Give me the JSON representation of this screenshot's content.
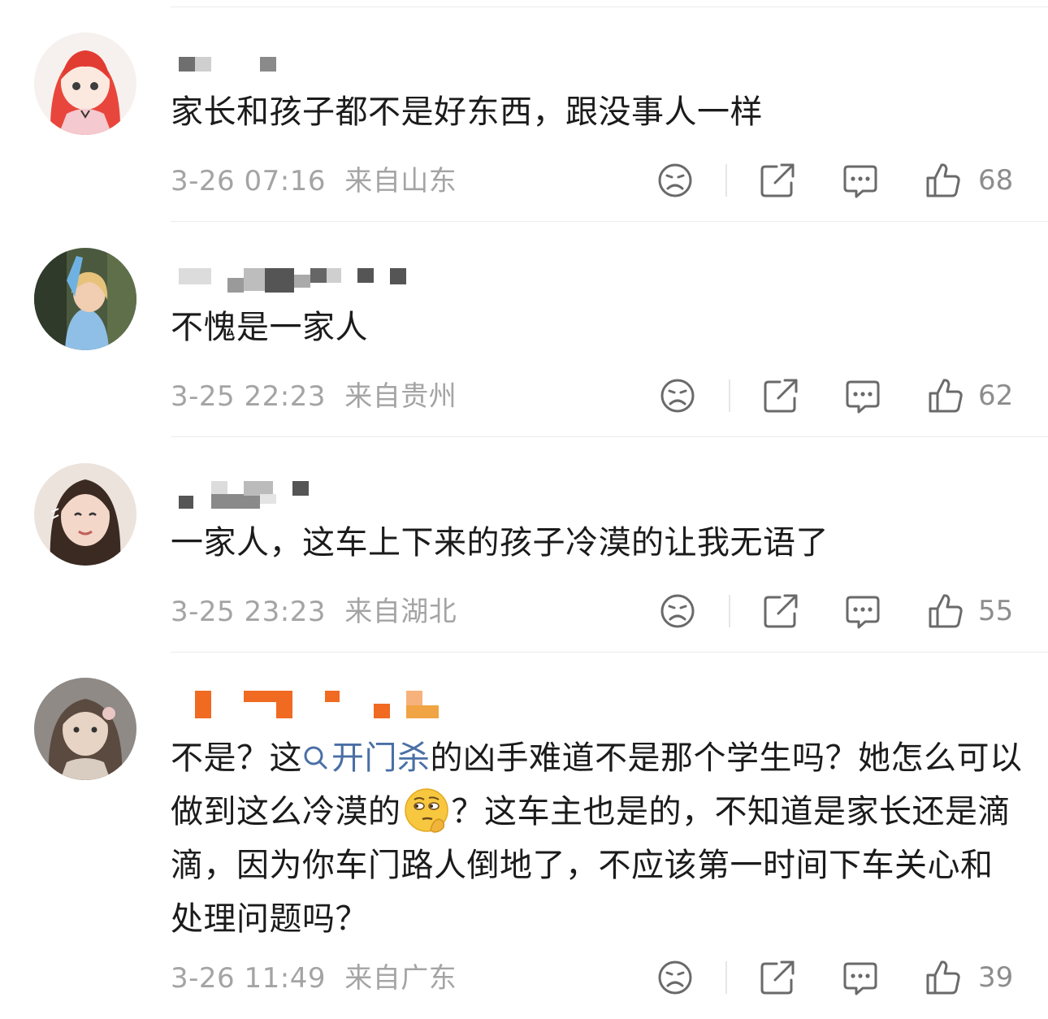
{
  "comments": [
    {
      "content": "家长和孩子都不是好东西，跟没事人一样",
      "time": "3-26 07:16",
      "location": "来自山东",
      "likes": "68"
    },
    {
      "content": "不愧是一家人",
      "time": "3-25 22:23",
      "location": "来自贵州",
      "likes": "62"
    },
    {
      "content": "一家人，这车上下来的孩子冷漠的让我无语了",
      "time": "3-25 23:23",
      "location": "来自湖北",
      "likes": "55"
    },
    {
      "content_part1": "不是？这",
      "link_text": "开门杀",
      "content_part2": "的凶手难道不是那个学生吗？她怎么可以做到这么冷漠的",
      "content_part3": "？这车主也是的，不知道是家长还是滴滴，因为你车门路人倒地了，不应该第一时间下车关心和处理问题吗？",
      "time": "3-26 11:49",
      "location": "来自广东",
      "likes": "39"
    }
  ],
  "icons": {
    "dislike": "sad-face-icon",
    "share": "share-icon",
    "reply": "comment-bubble-icon",
    "like": "thumbs-up-icon",
    "search": "search-icon",
    "emoji": "thinking-face-emoji"
  },
  "colors": {
    "meta_text": "#a4a4a4",
    "link": "#4a6fa5",
    "icon": "#6a6a6a"
  }
}
